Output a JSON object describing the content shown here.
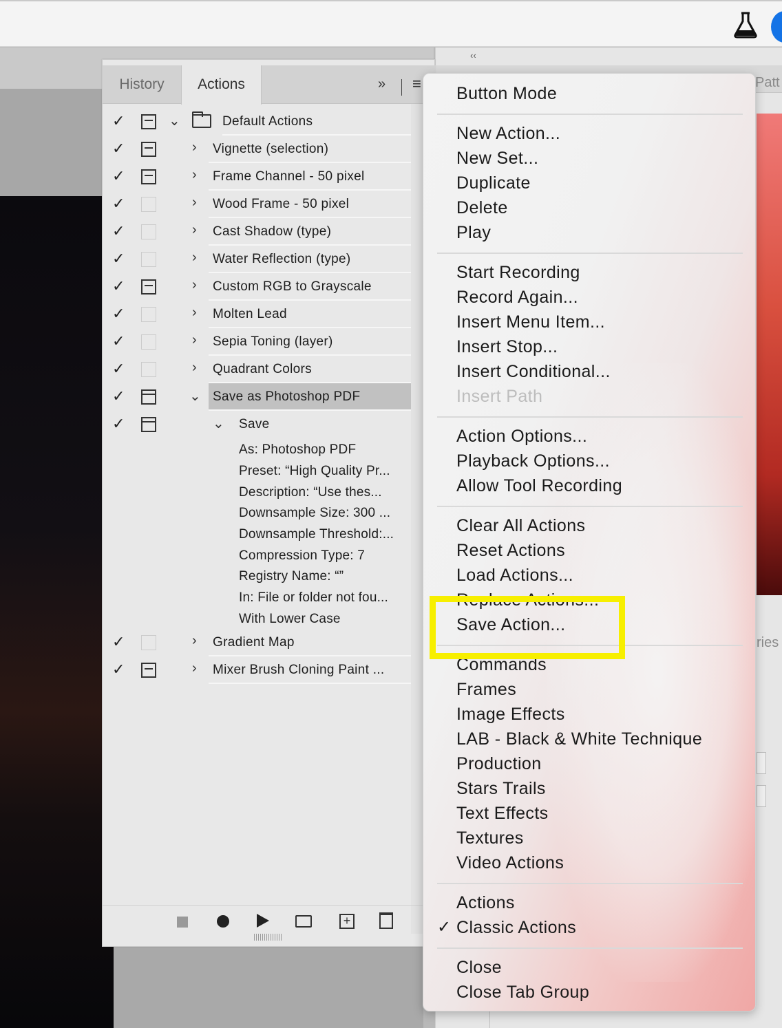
{
  "panel": {
    "tabs": [
      "History",
      "Actions"
    ],
    "collapse_glyph": "»",
    "menu_glyph": "≡"
  },
  "action_set": {
    "name": "Default Actions"
  },
  "actions": [
    "Vignette (selection)",
    "Frame Channel - 50 pixel",
    "Wood Frame - 50 pixel",
    "Cast Shadow (type)",
    "Water Reflection (type)",
    "Custom RGB to Grayscale",
    "Molten Lead",
    "Sepia Toning (layer)",
    "Quadrant Colors",
    "Save as Photoshop PDF"
  ],
  "expanded_step": {
    "name": "Save",
    "details": [
      "As: Photoshop PDF",
      "Preset:  “High Quality Pr...",
      "Description:  “Use thes...",
      "Downsample Size: 300 ...",
      "Downsample Threshold:...",
      "Compression Type: 7",
      "Registry Name:  “”",
      "In: File or folder not fou...",
      "With Lower Case"
    ]
  },
  "actions_after": [
    "Gradient Map",
    "Mixer Brush Cloning Paint ..."
  ],
  "right_dock": {
    "collapse_glyph": "‹‹",
    "tab_label": "Patt",
    "label_ries": "ries"
  },
  "menu": {
    "button_mode": "Button Mode",
    "group1": [
      "New Action...",
      "New Set...",
      "Duplicate",
      "Delete",
      "Play"
    ],
    "group2": [
      "Start Recording",
      "Record Again...",
      "Insert Menu Item...",
      "Insert Stop...",
      "Insert Conditional...",
      "Insert Path"
    ],
    "group3": [
      "Action Options...",
      "Playback Options...",
      "Allow Tool Recording"
    ],
    "group4": [
      "Clear All Actions",
      "Reset Actions",
      "Load Actions...",
      "Replace Actions...",
      "Save Action..."
    ],
    "sets": [
      "Commands",
      "Frames",
      "Image Effects",
      "LAB - Black & White Technique",
      "Production",
      "Stars Trails",
      "Text Effects",
      "Textures",
      "Video Actions"
    ],
    "workspace": [
      "Actions",
      "Classic Actions"
    ],
    "close": [
      "Close",
      "Close Tab Group"
    ],
    "check_glyph": "✓"
  },
  "highlight_color": "#f7ef00"
}
